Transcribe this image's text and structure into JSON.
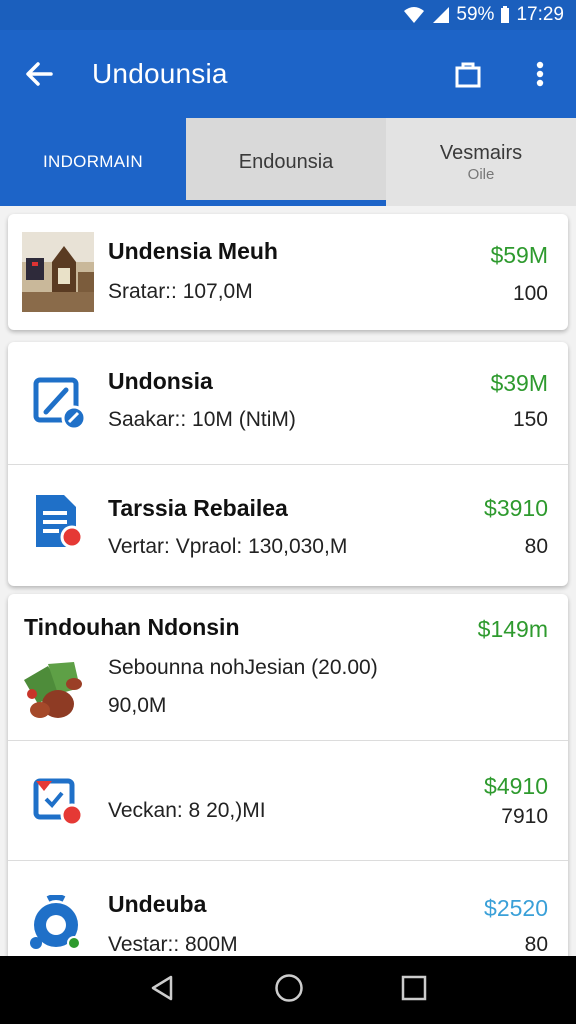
{
  "status_bar": {
    "battery": "59%",
    "time": "17:29"
  },
  "app_bar": {
    "title": "Undounsia"
  },
  "tabs": [
    {
      "label": "INDORMAIN",
      "sub": ""
    },
    {
      "label": "Endounsia",
      "sub": ""
    },
    {
      "label": "Vesmairs",
      "sub": "Oile"
    }
  ],
  "rows": [
    {
      "name": "Undensia Meuh",
      "sub": "Sratar:: 107,0M",
      "price": "$59M",
      "qty": "100",
      "icon": "museum-photo-icon"
    },
    {
      "name": "Undonsia",
      "sub": "Saakar:: 10M (NtiM)",
      "price": "$39M",
      "qty": "150",
      "icon": "edit-square-icon"
    },
    {
      "name": "Tarssia Rebailea",
      "sub": "Vertar: Vpraol: 130,030,M",
      "price": "$3910",
      "qty": "80",
      "icon": "document-icon"
    },
    {
      "name": "Tindouhan Ndonsin",
      "sub": "Sebounna nohJesian (20.00)",
      "sub2": "90,0M",
      "price": "$149m",
      "qty": "",
      "icon": "food-photo-icon"
    },
    {
      "name": "",
      "sub": "Veckan: 8 20,)MI",
      "price": "$4910",
      "qty": "7910",
      "icon": "calendar-check-icon"
    },
    {
      "name": "Undeuba",
      "sub": "Vestar:: 800M",
      "price": "$2520",
      "qty": "80",
      "icon": "chrome-circle-icon"
    }
  ],
  "colors": {
    "primary": "#1d64c8",
    "price_green": "#2e9a2e",
    "price_blue": "#3aa0d8"
  }
}
